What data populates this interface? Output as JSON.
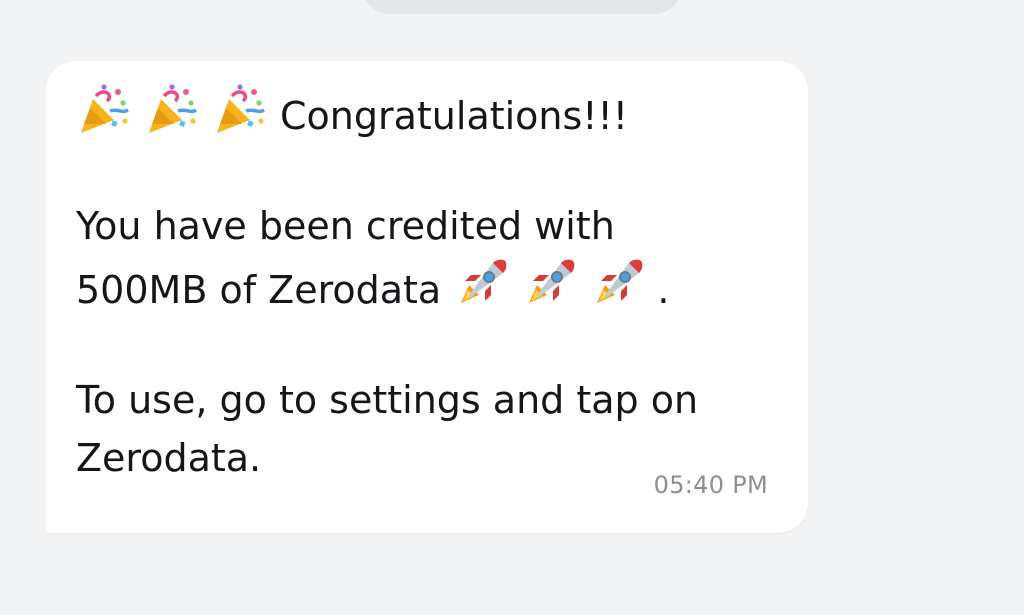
{
  "message": {
    "line1_text": "Congratulations!!!",
    "line2_text": "You have been credited with",
    "line3_text": "500MB of Zerodata",
    "line3_suffix": ".",
    "line4_text": "To use, go to settings and tap on",
    "line5_text": "Zerodata.",
    "timestamp": "05:40 PM",
    "leading_icons": [
      "party-popper-icon",
      "party-popper-icon",
      "party-popper-icon"
    ],
    "trailing_icons": [
      "rocket-icon",
      "rocket-icon",
      "rocket-icon"
    ]
  },
  "colors": {
    "background": "#f2f3f5",
    "bubble": "#ffffff",
    "text": "#16161a",
    "timestamp": "#8a8f98",
    "previous_bubble": "#e4e5e7"
  }
}
